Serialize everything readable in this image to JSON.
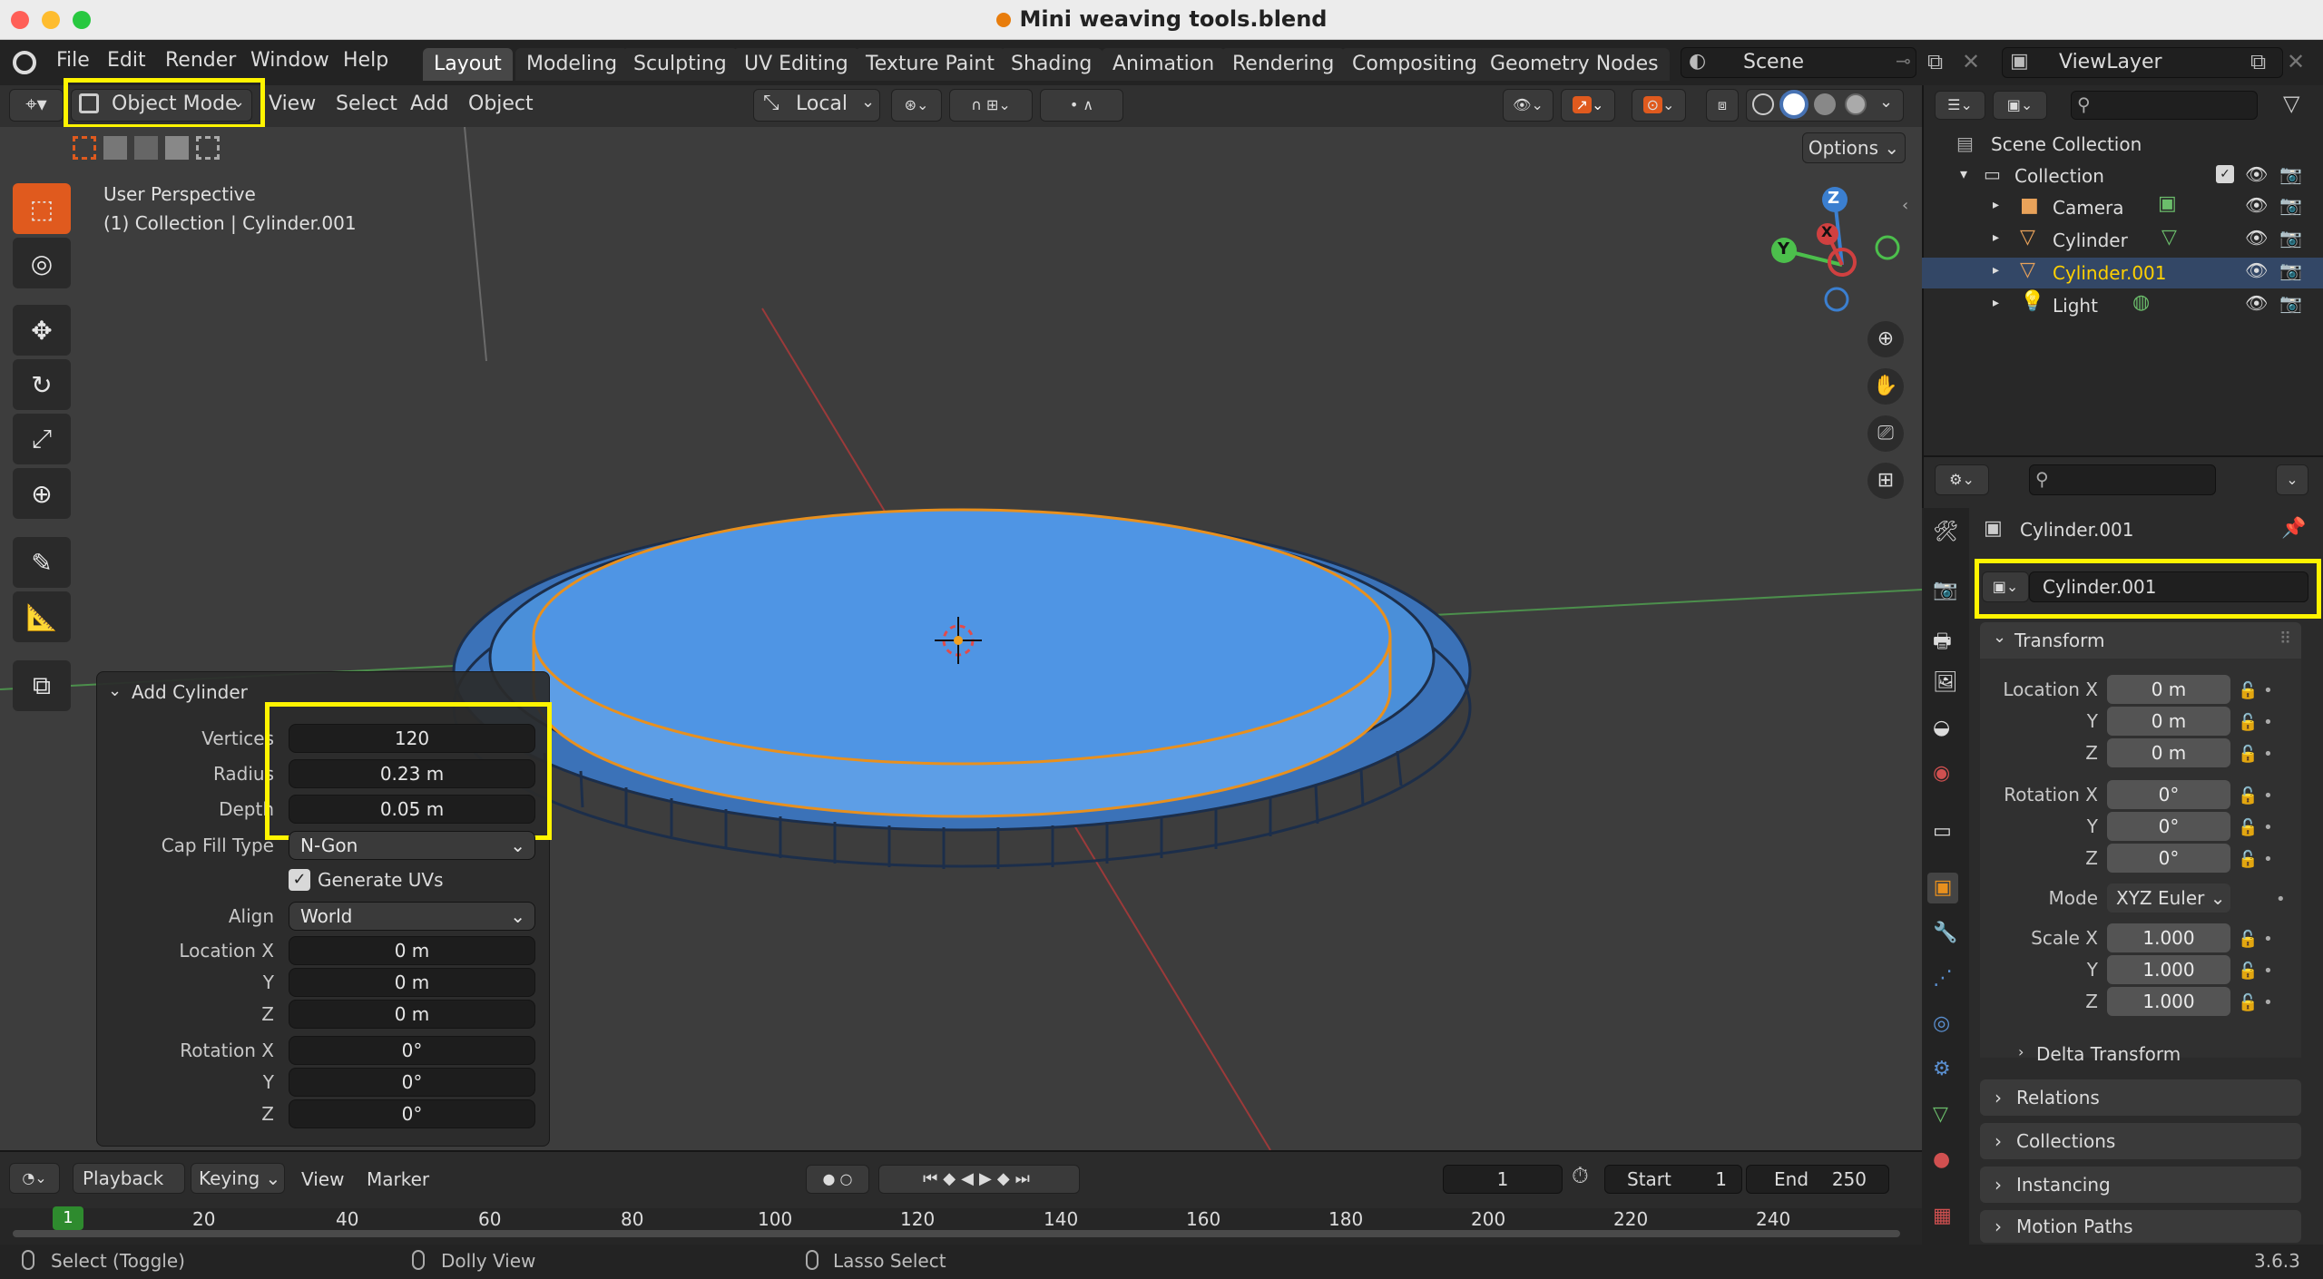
{
  "window": {
    "title": "Mini weaving tools.blend"
  },
  "menu": {
    "file": "File",
    "edit": "Edit",
    "render": "Render",
    "window": "Window",
    "help": "Help"
  },
  "workspaces": [
    "Layout",
    "Modeling",
    "Sculpting",
    "UV Editing",
    "Texture Paint",
    "Shading",
    "Animation",
    "Rendering",
    "Compositing",
    "Geometry Nodes"
  ],
  "scene": {
    "name": "Scene",
    "view_layer": "ViewLayer"
  },
  "viewport_header": {
    "mode": "Object Mode",
    "view": "View",
    "select": "Select",
    "add": "Add",
    "object": "Object",
    "orientation": "Local",
    "options": "Options"
  },
  "viewport": {
    "perspective": "User Perspective",
    "context": "(1) Collection | Cylinder.001",
    "gizmo": {
      "x": "X",
      "y": "Y",
      "z": "Z"
    }
  },
  "operator_panel": {
    "title": "Add Cylinder",
    "vertices_label": "Vertices",
    "vertices": "120",
    "radius_label": "Radius",
    "radius": "0.23 m",
    "depth_label": "Depth",
    "depth": "0.05 m",
    "cap_fill_label": "Cap Fill Type",
    "cap_fill": "N-Gon",
    "generate_uvs": "Generate UVs",
    "align_label": "Align",
    "align": "World",
    "location_x_label": "Location X",
    "location_x": "0 m",
    "location_y_label": "Y",
    "location_y": "0 m",
    "location_z_label": "Z",
    "location_z": "0 m",
    "rotation_x_label": "Rotation X",
    "rotation_x": "0°",
    "rotation_y_label": "Y",
    "rotation_y": "0°",
    "rotation_z_label": "Z",
    "rotation_z": "0°"
  },
  "outliner": {
    "scene_collection": "Scene Collection",
    "collection": "Collection",
    "items": [
      {
        "name": "Camera",
        "icon": "camera-icon",
        "color": "#e8a25a"
      },
      {
        "name": "Cylinder",
        "icon": "mesh-icon",
        "color": "#e8a25a"
      },
      {
        "name": "Cylinder.001",
        "icon": "mesh-icon",
        "color": "#e8a25a",
        "selected": true
      },
      {
        "name": "Light",
        "icon": "light-icon",
        "color": "#e8a25a"
      }
    ]
  },
  "properties": {
    "object_name_header": "Cylinder.001",
    "object_name_field": "Cylinder.001",
    "transform": "Transform",
    "location_x_label": "Location X",
    "location_x": "0 m",
    "location_y_label": "Y",
    "location_y": "0 m",
    "location_z_label": "Z",
    "location_z": "0 m",
    "rotation_x_label": "Rotation X",
    "rotation_x": "0°",
    "rotation_y_label": "Y",
    "rotation_y": "0°",
    "rotation_z_label": "Z",
    "rotation_z": "0°",
    "mode_label": "Mode",
    "mode": "XYZ Euler",
    "scale_x_label": "Scale X",
    "scale_x": "1.000",
    "scale_y_label": "Y",
    "scale_y": "1.000",
    "scale_z_label": "Z",
    "scale_z": "1.000",
    "delta_transform": "Delta Transform",
    "relations": "Relations",
    "collections": "Collections",
    "instancing": "Instancing",
    "motion_paths": "Motion Paths"
  },
  "timeline": {
    "playback": "Playback",
    "keying": "Keying",
    "view": "View",
    "marker": "Marker",
    "current_frame": "1",
    "start_label": "Start",
    "start": "1",
    "end_label": "End",
    "end": "250",
    "ruler": [
      "1",
      "20",
      "40",
      "60",
      "80",
      "100",
      "120",
      "140",
      "160",
      "180",
      "200",
      "220",
      "240"
    ]
  },
  "statusbar": {
    "select": "Select (Toggle)",
    "dolly": "Dolly View",
    "lasso": "Lasso Select",
    "version": "3.6.3"
  },
  "colors": {
    "highlight": "#fff400",
    "mesh_blue": "#4a90e2",
    "active_object": "#ffd000",
    "tool_active": "#e05a1e"
  }
}
